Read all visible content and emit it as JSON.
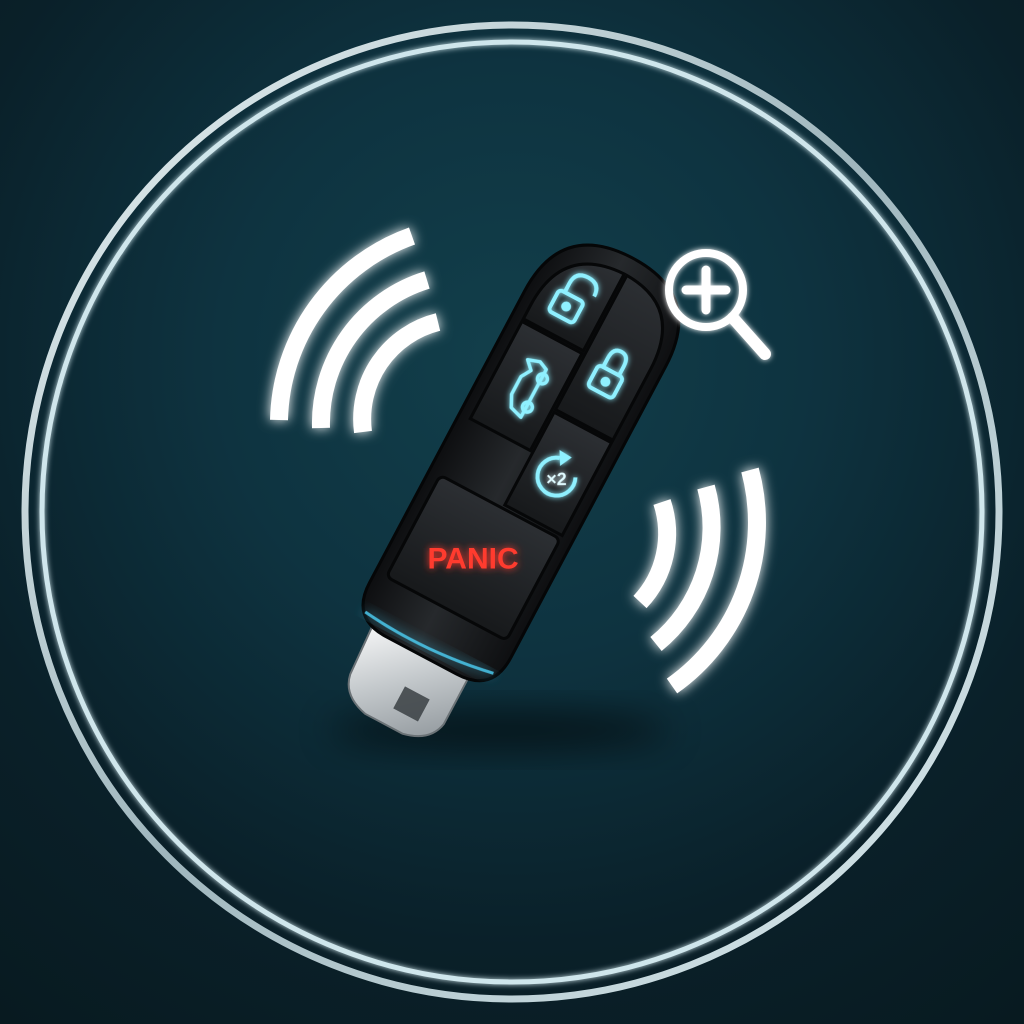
{
  "fob": {
    "buttons": [
      {
        "name": "unlock",
        "icon": "unlock-icon"
      },
      {
        "name": "lock",
        "icon": "lock-icon"
      },
      {
        "name": "trunk",
        "icon": "car-trunk-icon"
      },
      {
        "name": "remote-start",
        "icon": "remote-start-icon",
        "label": "×2"
      },
      {
        "name": "panic",
        "label": "PANIC"
      }
    ]
  },
  "colors": {
    "background_center": "#123f4b",
    "background_edge": "#081a20",
    "ring": "#cfe6ec",
    "glow": "#4fd8ff",
    "panic": "#ff3b2f",
    "fob_body": "#1a1c1e"
  },
  "icons": [
    "signal-waves-icon",
    "zoom-in-icon"
  ]
}
